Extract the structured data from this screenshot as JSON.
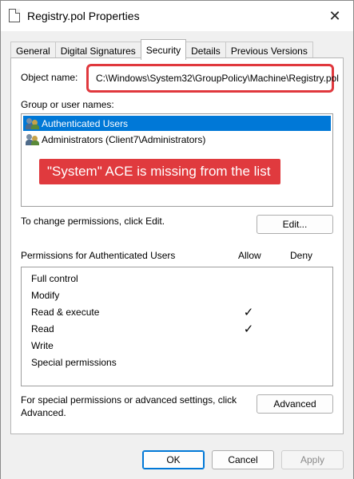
{
  "window": {
    "title": "Registry.pol Properties",
    "close_glyph": "✕"
  },
  "tabs": [
    {
      "label": "General"
    },
    {
      "label": "Digital Signatures"
    },
    {
      "label": "Security",
      "active": true
    },
    {
      "label": "Details"
    },
    {
      "label": "Previous Versions"
    }
  ],
  "security": {
    "object_name_label": "Object name:",
    "object_name_value": "C:\\Windows\\System32\\GroupPolicy\\Machine\\Registry.pol",
    "group_label": "Group or user names:",
    "users": [
      {
        "name": "Authenticated Users",
        "selected": true
      },
      {
        "name": "Administrators (Client7\\Administrators)",
        "selected": false
      }
    ],
    "annotation": "\"System\" ACE is missing from the list",
    "change_text": "To change permissions, click Edit.",
    "edit_button": "Edit...",
    "permissions_header": "Permissions for Authenticated Users",
    "allow_header": "Allow",
    "deny_header": "Deny",
    "permissions": [
      {
        "name": "Full control",
        "allow": "",
        "deny": ""
      },
      {
        "name": "Modify",
        "allow": "",
        "deny": ""
      },
      {
        "name": "Read & execute",
        "allow": "✓",
        "deny": ""
      },
      {
        "name": "Read",
        "allow": "✓",
        "deny": ""
      },
      {
        "name": "Write",
        "allow": "",
        "deny": ""
      },
      {
        "name": "Special permissions",
        "allow": "",
        "deny": ""
      }
    ],
    "advanced_text_line1": "For special permissions or advanced settings, click",
    "advanced_text_line2": "Advanced.",
    "advanced_button": "Advanced"
  },
  "footer": {
    "ok": "OK",
    "cancel": "Cancel",
    "apply": "Apply"
  },
  "colors": {
    "selection": "#0078d7",
    "highlight": "#e0383d"
  }
}
